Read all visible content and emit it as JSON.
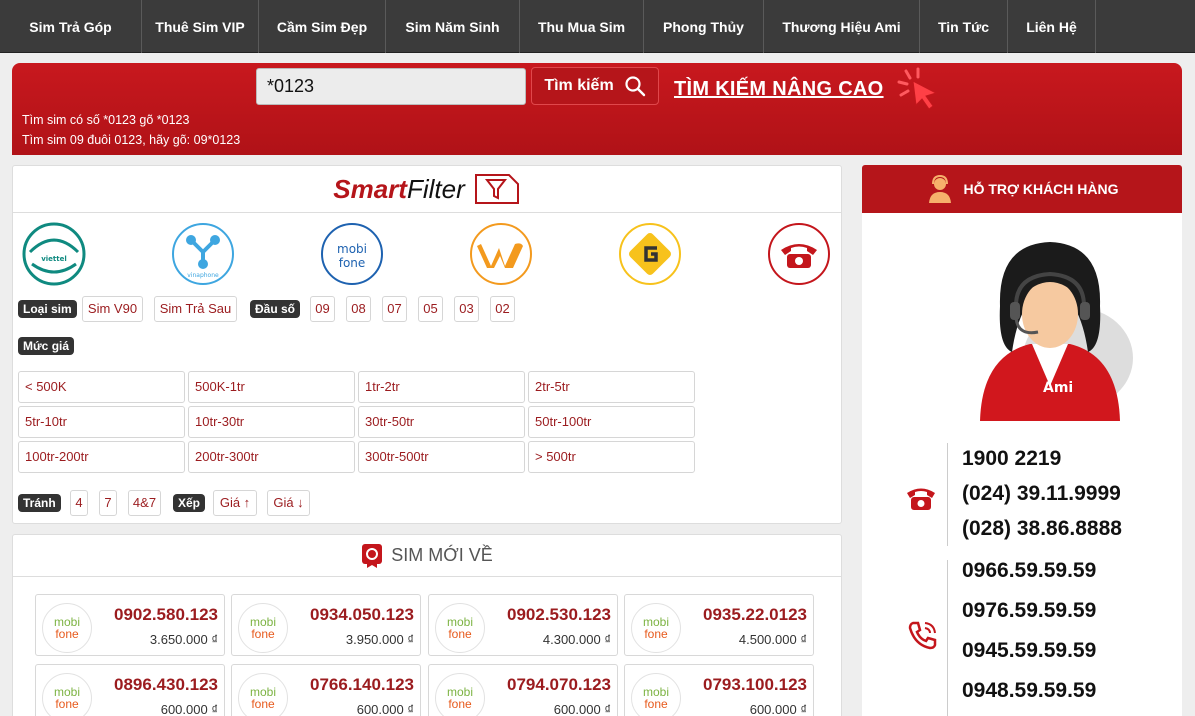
{
  "nav": [
    "Sim Trả Góp",
    "Thuê Sim VIP",
    "Cầm Sim Đẹp",
    "Sim Năm Sinh",
    "Thu Mua Sim",
    "Phong Thủy",
    "Thương Hiệu Ami",
    "Tin Tức",
    "Liên Hệ"
  ],
  "search": {
    "value": "*0123",
    "button": "Tìm kiếm",
    "advanced": "TÌM KIẾM NÂNG CAO",
    "hint1": "Tìm sim có số *0123 gõ *0123",
    "hint2": "Tìm sim 09 đuôi 0123, hãy gõ: 09*0123"
  },
  "smartfilter": {
    "title_a": "Smart",
    "title_b": "Filter",
    "networks": [
      "viettel",
      "vinaphone",
      "mobifone",
      "vietnamobile",
      "gmobile",
      "itelecom"
    ],
    "loai_sim_label": "Loại sim",
    "loai_sim": [
      "Sim V90",
      "Sim Trả Sau"
    ],
    "dau_so_label": "Đầu số",
    "dau_so": [
      "09",
      "08",
      "07",
      "05",
      "03",
      "02"
    ],
    "muc_gia_label": "Mức giá",
    "muc_gia": [
      "< 500K",
      "500K-1tr",
      "1tr-2tr",
      "2tr-5tr",
      "5tr-10tr",
      "10tr-30tr",
      "30tr-50tr",
      "50tr-100tr",
      "100tr-200tr",
      "200tr-300tr",
      "300tr-500tr",
      "> 500tr"
    ],
    "tranh_label": "Tránh",
    "tranh": [
      "4",
      "7",
      "4&7"
    ],
    "xep_label": "Xếp",
    "xep": [
      "Giá ↑",
      "Giá ↓"
    ]
  },
  "new_sims": {
    "title": "SIM MỚI VỀ",
    "logo_top": "mobi",
    "logo_bottom": "fone",
    "items": [
      {
        "number": "0902.580.123",
        "price": "3.650.000 ₫"
      },
      {
        "number": "0934.050.123",
        "price": "3.950.000 ₫"
      },
      {
        "number": "0902.530.123",
        "price": "4.300.000 ₫"
      },
      {
        "number": "0935.22.0123",
        "price": "4.500.000 ₫"
      },
      {
        "number": "0896.430.123",
        "price": "600.000 ₫"
      },
      {
        "number": "0766.140.123",
        "price": "600.000 ₫"
      },
      {
        "number": "0794.070.123",
        "price": "600.000 ₫"
      },
      {
        "number": "0793.100.123",
        "price": "600.000 ₫"
      }
    ]
  },
  "support": {
    "title": "HỖ TRỢ KHÁCH HÀNG",
    "landlines": [
      "1900 2219",
      "(024) 39.11.9999",
      "(028) 38.86.8888"
    ],
    "mobiles": [
      "0966.59.59.59",
      "0976.59.59.59",
      "0945.59.59.59",
      "0948.59.59.59"
    ]
  }
}
